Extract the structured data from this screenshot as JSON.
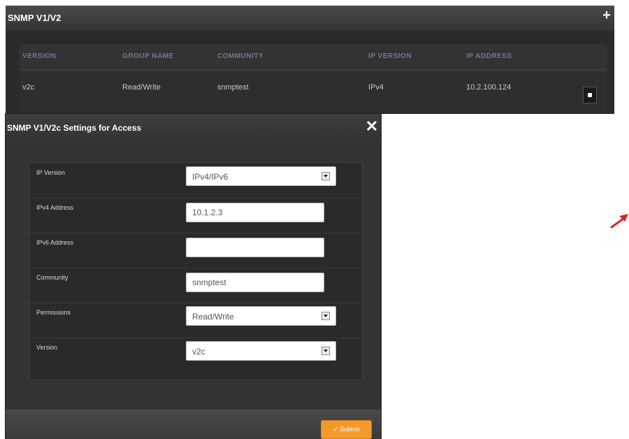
{
  "snmp_panel": {
    "title": "SNMP V1/V2",
    "add_icon": "plus-icon",
    "add_label": "+",
    "columns": [
      "VERSION",
      "GROUP NAME",
      "COMMUNITY",
      "IP VERSION",
      "IP ADDRESS"
    ],
    "rows": [
      {
        "version": "v2c",
        "group_name": "Read/Write",
        "community": "snmptest",
        "ip_version": "IPv4",
        "ip_address": "10.2.100.124"
      }
    ]
  },
  "modal": {
    "title": "SNMP V1/V2c Settings for Access",
    "close_label": "✕",
    "fields": {
      "ip_version": {
        "label": "IP Version",
        "value": "IPv4/IPv6"
      },
      "ipv4_address": {
        "label": "IPv4 Address",
        "value": "10.1.2.3"
      },
      "ipv6_address": {
        "label": "IPv6 Address",
        "value": ""
      },
      "community": {
        "label": "Community",
        "value": "snmptest"
      },
      "permissions": {
        "label": "Permissions",
        "value": "Read/Write"
      },
      "version": {
        "label": "Version",
        "value": "v2c"
      }
    },
    "submit_label": "✓ Submit"
  },
  "colors": {
    "submit": "#f39a2c",
    "arrow": "#e02020"
  }
}
